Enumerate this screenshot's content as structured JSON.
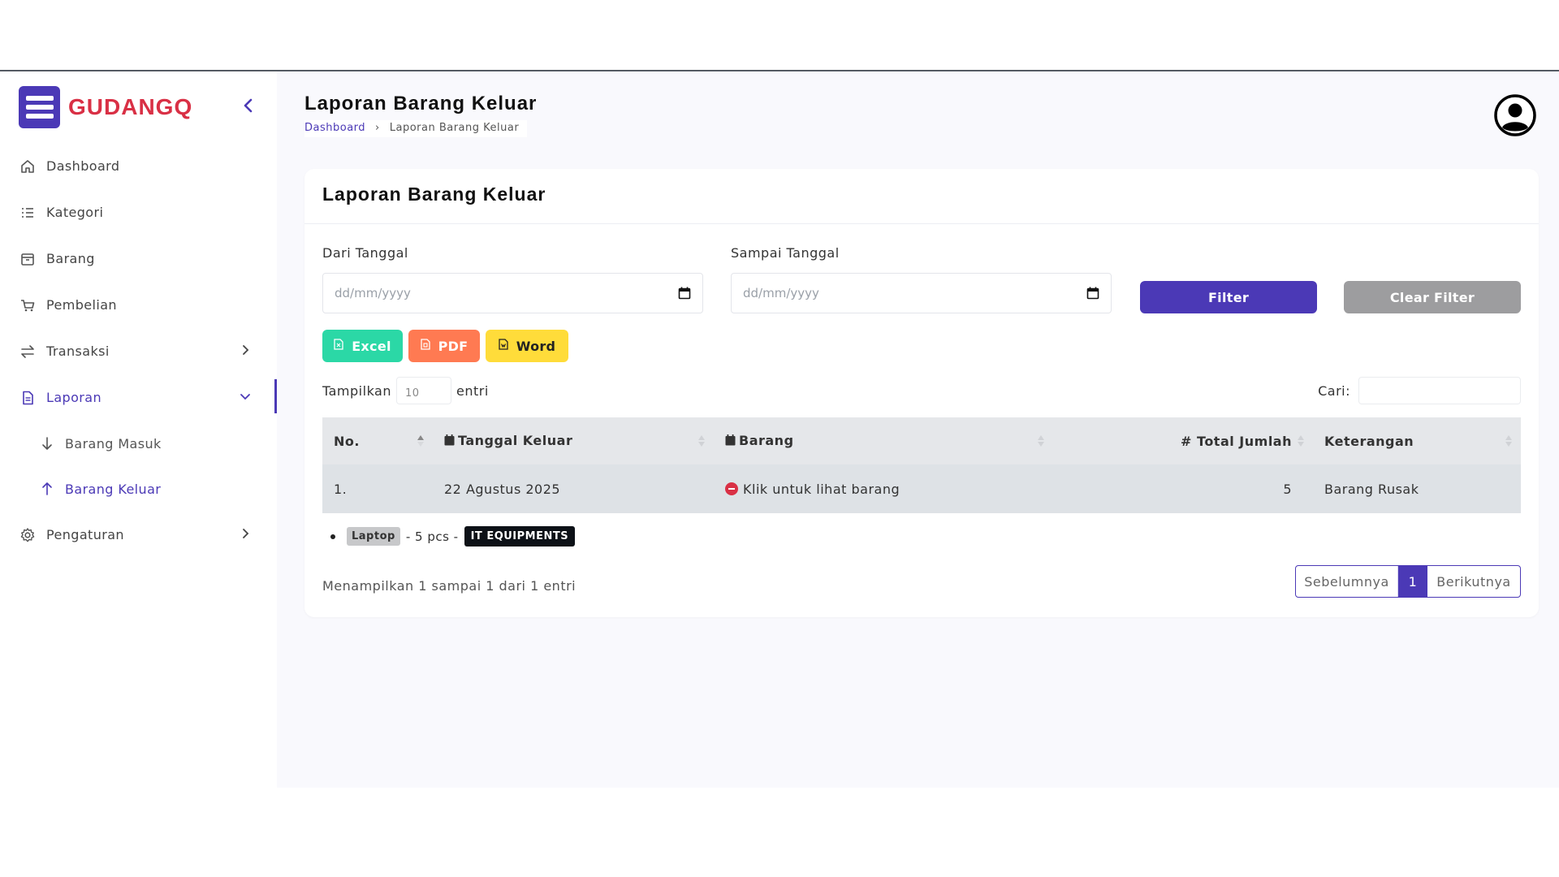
{
  "brand": {
    "name": "GUDANGQ"
  },
  "sidebar": {
    "items": [
      {
        "label": "Dashboard",
        "icon": "home-icon"
      },
      {
        "label": "Kategori",
        "icon": "list-icon"
      },
      {
        "label": "Barang",
        "icon": "box-icon"
      },
      {
        "label": "Pembelian",
        "icon": "cart-icon"
      },
      {
        "label": "Transaksi",
        "icon": "transfer-icon"
      },
      {
        "label": "Laporan",
        "icon": "report-icon"
      },
      {
        "label": "Pengaturan",
        "icon": "gear-icon"
      }
    ],
    "sub_items": [
      {
        "label": "Barang Masuk",
        "icon": "arrow-down-icon"
      },
      {
        "label": "Barang Keluar",
        "icon": "arrow-up-icon"
      }
    ]
  },
  "header": {
    "title": "Laporan Barang Keluar",
    "breadcrumb": {
      "home": "Dashboard",
      "current": "Laporan Barang Keluar"
    }
  },
  "card": {
    "title": "Laporan Barang Keluar",
    "filter": {
      "from_label": "Dari Tanggal",
      "to_label": "Sampai Tanggal",
      "from_placeholder": "dd/mm/yyyy",
      "to_placeholder": "dd/mm/yyyy",
      "filter_button": "Filter",
      "clear_button": "Clear Filter"
    },
    "exports": {
      "excel": "Excel",
      "pdf": "PDF",
      "word": "Word"
    },
    "length": {
      "prefix": "Tampilkan",
      "value": "10",
      "suffix": "entri"
    },
    "search": {
      "label": "Cari:"
    },
    "table": {
      "headers": [
        "No.",
        "Tanggal Keluar",
        "Barang",
        "# Total Jumlah",
        "Keterangan"
      ],
      "rows": [
        {
          "no": "1.",
          "tanggal": "22 Agustus 2025",
          "barang": "Klik untuk lihat barang",
          "total": "5",
          "keterangan": "Barang Rusak"
        }
      ]
    },
    "detail": {
      "item": "Laptop",
      "qty": "- 5 pcs -",
      "category": "IT EQUIPMENTS"
    },
    "info": "Menampilkan 1 sampai 1 dari 1 entri",
    "pagination": {
      "prev": "Sebelumnya",
      "current": "1",
      "next": "Berikutnya"
    }
  },
  "colors": {
    "accent": "#4b39b6",
    "brand_text": "#d93045",
    "excel": "#2bd8a6",
    "pdf": "#ff7a52",
    "word": "#ffdc3a"
  }
}
